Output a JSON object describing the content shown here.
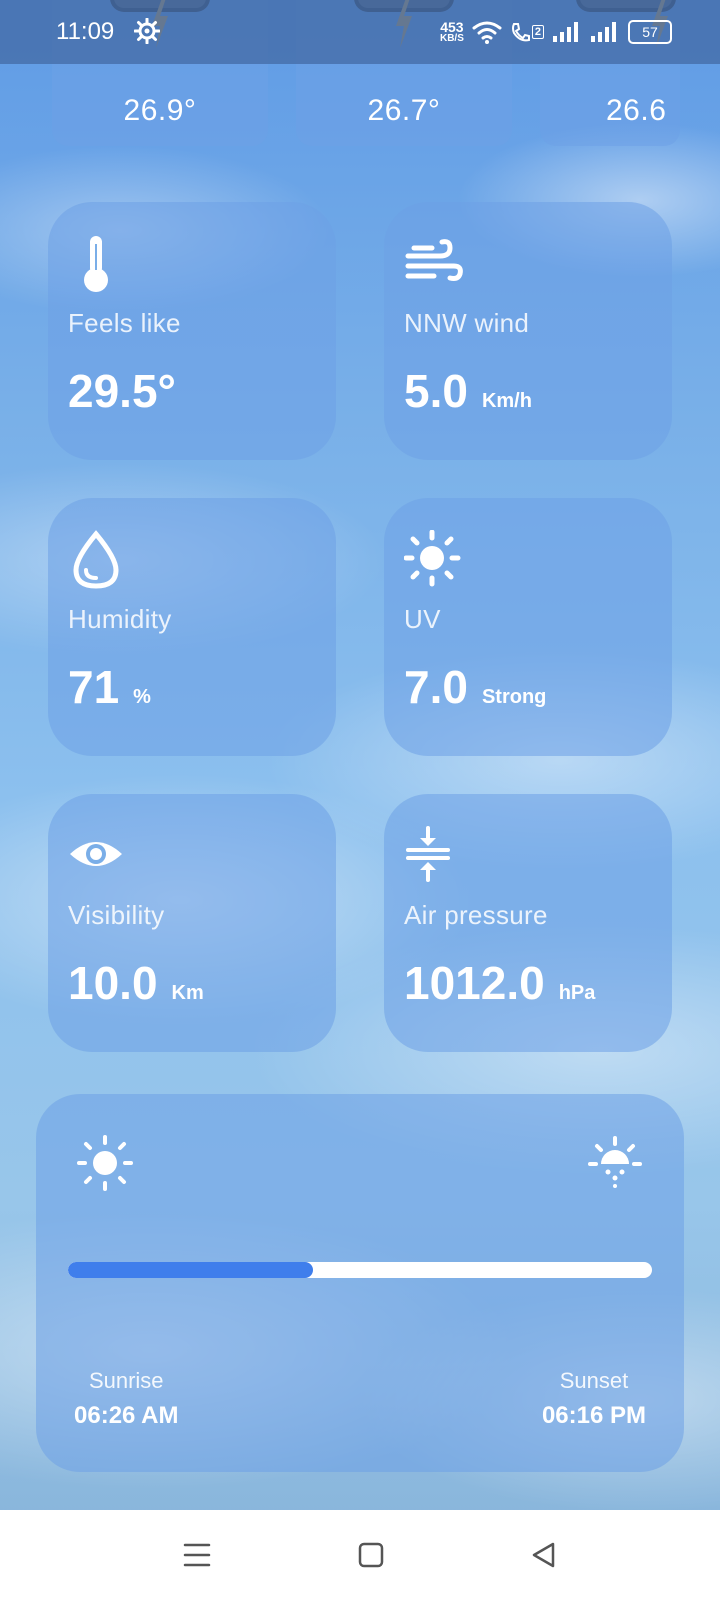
{
  "status_bar": {
    "time": "11:09",
    "net_speed_value": "453",
    "net_speed_unit": "KB/S",
    "sim_label": "2",
    "battery": "57"
  },
  "hourly": [
    {
      "temp": "26.9°"
    },
    {
      "temp": "26.7°"
    },
    {
      "temp": "26.6"
    }
  ],
  "tiles": [
    {
      "label": "Feels like",
      "value": "29.5°",
      "unit": "",
      "icon": "thermometer-icon"
    },
    {
      "label": "NNW wind",
      "value": "5.0",
      "unit": "Km/h",
      "icon": "wind-icon"
    },
    {
      "label": "Humidity",
      "value": "71",
      "unit": "%",
      "icon": "water-drop-icon"
    },
    {
      "label": "UV",
      "value": "7.0",
      "unit": "Strong",
      "icon": "sun-icon"
    },
    {
      "label": "Visibility",
      "value": "10.0",
      "unit": "Km",
      "icon": "eye-icon"
    },
    {
      "label": "Air pressure",
      "value": "1012.0",
      "unit": "hPa",
      "icon": "pressure-icon"
    }
  ],
  "sun": {
    "sunrise_label": "Sunrise",
    "sunrise_time": "06:26 AM",
    "sunset_label": "Sunset",
    "sunset_time": "06:16 PM",
    "day_progress_percent": 42
  },
  "colors": {
    "accent": "#3f7eec",
    "bolt": "#f5a623"
  }
}
